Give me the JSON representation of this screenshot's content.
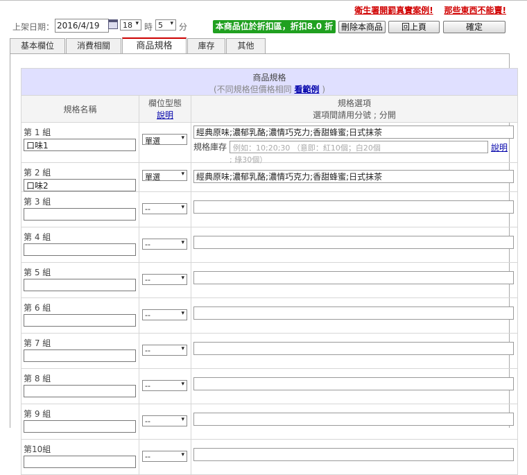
{
  "top_links": [
    "衛生署開罰真實案例!",
    "那些東西不能賣!"
  ],
  "toolbar": {
    "date_label": "上架日期：",
    "date_value": "2016/4/19",
    "hour_value": "18",
    "hour_suffix": "時",
    "minute_value": "5",
    "minute_suffix": "分",
    "discount_badge": "本商品位於折扣區，折扣8.0 折",
    "delete_label": "刪除本商品",
    "back_label": "回上頁",
    "confirm_label": "確定"
  },
  "tabs": [
    {
      "label": "基本欄位",
      "active": false
    },
    {
      "label": "消費相關",
      "active": false
    },
    {
      "label": "商品規格",
      "active": true
    },
    {
      "label": "庫存",
      "active": false
    },
    {
      "label": "其他",
      "active": false
    }
  ],
  "spec_table": {
    "title": "商品規格",
    "subtitle_prefix": "(不同規格但價格相同",
    "subtitle_link": "看範例",
    "subtitle_suffix": ")",
    "col_name": "規格名稱",
    "col_type": "欄位型態",
    "col_type_help": "說明",
    "col_options": "規格選項",
    "col_options_hint": "選項間請用分號 ; 分開",
    "stock_label": "規格庫存",
    "stock_placeholder": "例如：10;20;30 （意即：紅10個；白20個",
    "stock_placeholder_cont": "; 綠30個）",
    "stock_help": "說明",
    "rows": [
      {
        "group": "第 1 組",
        "name": "口味1",
        "type": "單選",
        "options": "經典原味;濃郁乳酪;濃情巧克力;香甜蜂蜜;日式抹茶"
      },
      {
        "group": "第 2 組",
        "name": "口味2",
        "type": "單選",
        "options": "經典原味;濃郁乳酪;濃情巧克力;香甜蜂蜜;日式抹茶"
      },
      {
        "group": "第 3 組",
        "name": "",
        "type": "--",
        "options": ""
      },
      {
        "group": "第 4 組",
        "name": "",
        "type": "--",
        "options": ""
      },
      {
        "group": "第 5 組",
        "name": "",
        "type": "--",
        "options": ""
      },
      {
        "group": "第 6 組",
        "name": "",
        "type": "--",
        "options": ""
      },
      {
        "group": "第 7 組",
        "name": "",
        "type": "--",
        "options": ""
      },
      {
        "group": "第 8 組",
        "name": "",
        "type": "--",
        "options": ""
      },
      {
        "group": "第 9 組",
        "name": "",
        "type": "--",
        "options": ""
      },
      {
        "group": "第10組",
        "name": "",
        "type": "--",
        "options": ""
      }
    ]
  },
  "colors": {
    "accent_red": "#d00000",
    "badge_green": "#20a020",
    "header_lavender": "#e0e0ff",
    "link_blue": "#0000aa"
  }
}
